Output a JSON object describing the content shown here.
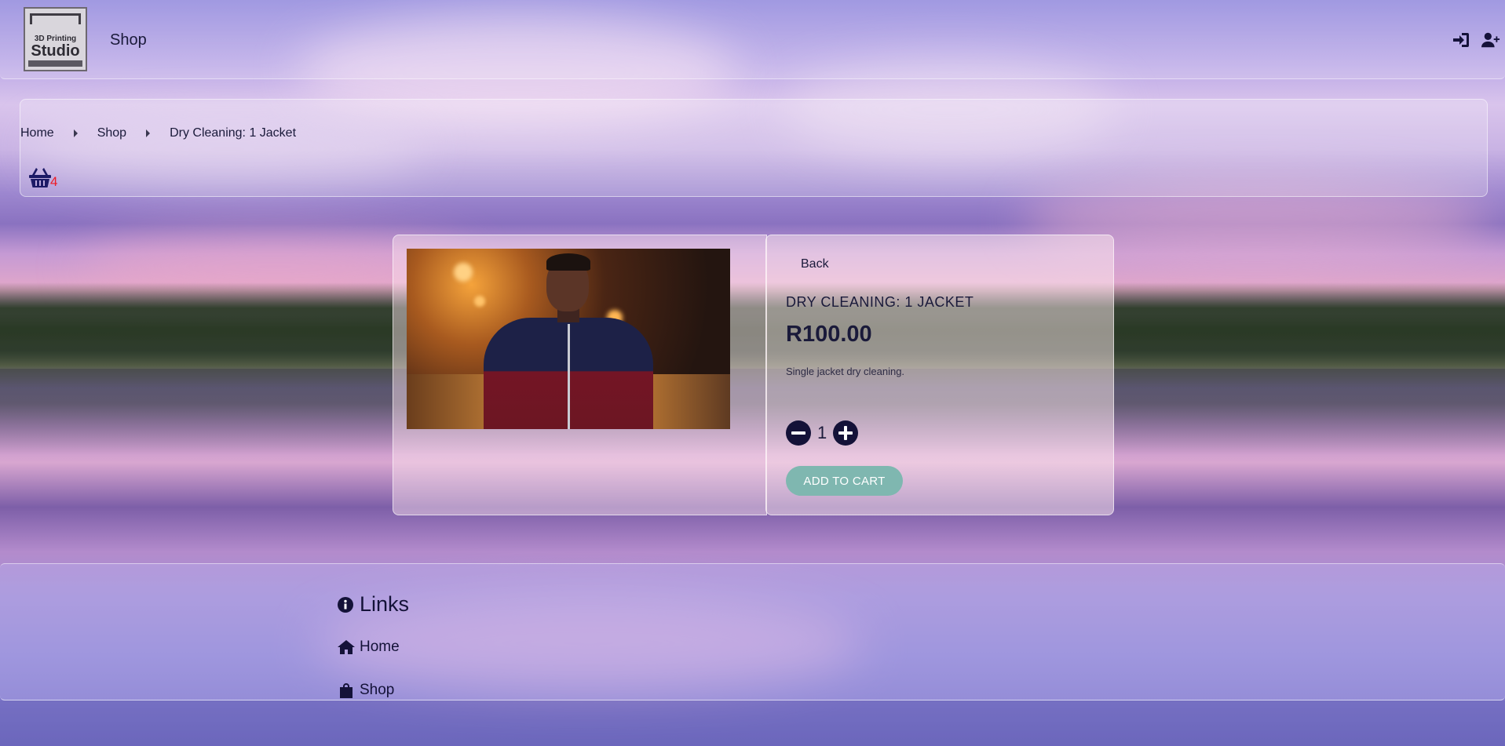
{
  "header": {
    "logo_line1": "3D Printing",
    "logo_line2": "Studio",
    "title": "Shop",
    "icons": [
      "sign-in-icon",
      "user-plus-icon"
    ]
  },
  "breadcrumb": {
    "items": [
      "Home",
      "Shop",
      "Dry Cleaning: 1 Jacket"
    ]
  },
  "basket": {
    "icon": "basket-icon",
    "count": "4",
    "count_color": "#ee1b24"
  },
  "product": {
    "back_label": "Back",
    "title": "DRY CLEANING: 1 JACKET",
    "price": "R100.00",
    "description": "Single jacket dry cleaning.",
    "quantity": "1",
    "add_to_cart_label": "ADD TO CART",
    "button_color": "#7fb7b0"
  },
  "footer": {
    "heading": "Links",
    "links": [
      "Home",
      "Shop"
    ]
  }
}
